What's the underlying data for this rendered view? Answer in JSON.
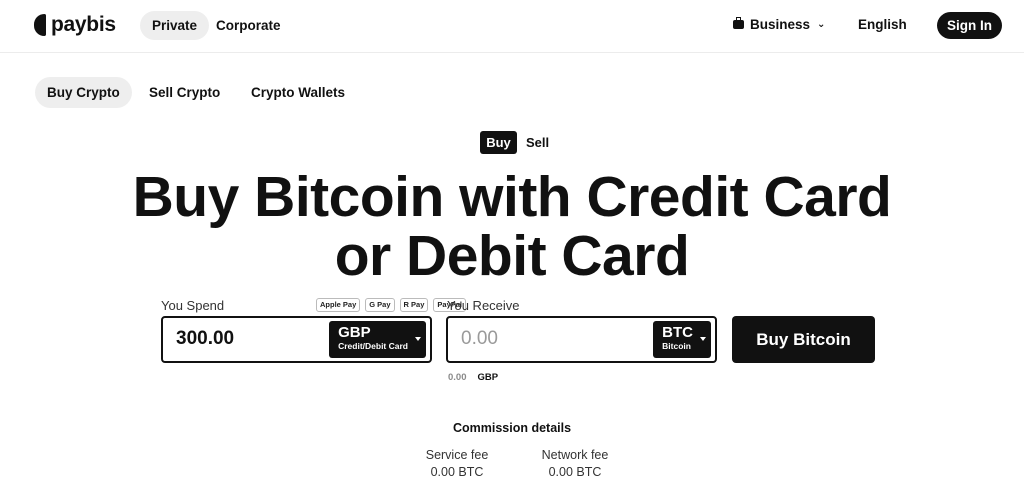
{
  "brand": {
    "name": "paybis"
  },
  "header": {
    "segments": [
      "Private",
      "Corporate"
    ],
    "business_label": "Business",
    "language": "English",
    "signin_label": "Sign In"
  },
  "tabs": [
    "Buy Crypto",
    "Sell Crypto",
    "Crypto Wallets"
  ],
  "mode_toggle": {
    "buy": "Buy",
    "sell": "Sell",
    "active": "Buy"
  },
  "hero": {
    "title": "Buy Bitcoin with Credit Card or Debit Card"
  },
  "spend": {
    "label": "You Spend",
    "value": "300.00",
    "currency": "GBP",
    "method": "Credit/Debit Card",
    "payment_icons": [
      "Apple Pay",
      "G Pay",
      "R Pay",
      "PayPal"
    ]
  },
  "receive": {
    "label": "You Receive",
    "placeholder": "0.00",
    "currency": "BTC",
    "currency_name": "Bitcoin"
  },
  "buy_button": "Buy Bitcoin",
  "conversion": {
    "value": "0.00",
    "currency": "GBP"
  },
  "commission": {
    "title": "Commission details",
    "service_fee_label": "Service fee",
    "service_fee_value": "0.00 BTC",
    "network_fee_label": "Network fee",
    "network_fee_value": "0.00 BTC"
  },
  "colors": {
    "primary": "#111111",
    "muted_bg": "#eeeeee",
    "background": "#ffffff"
  }
}
